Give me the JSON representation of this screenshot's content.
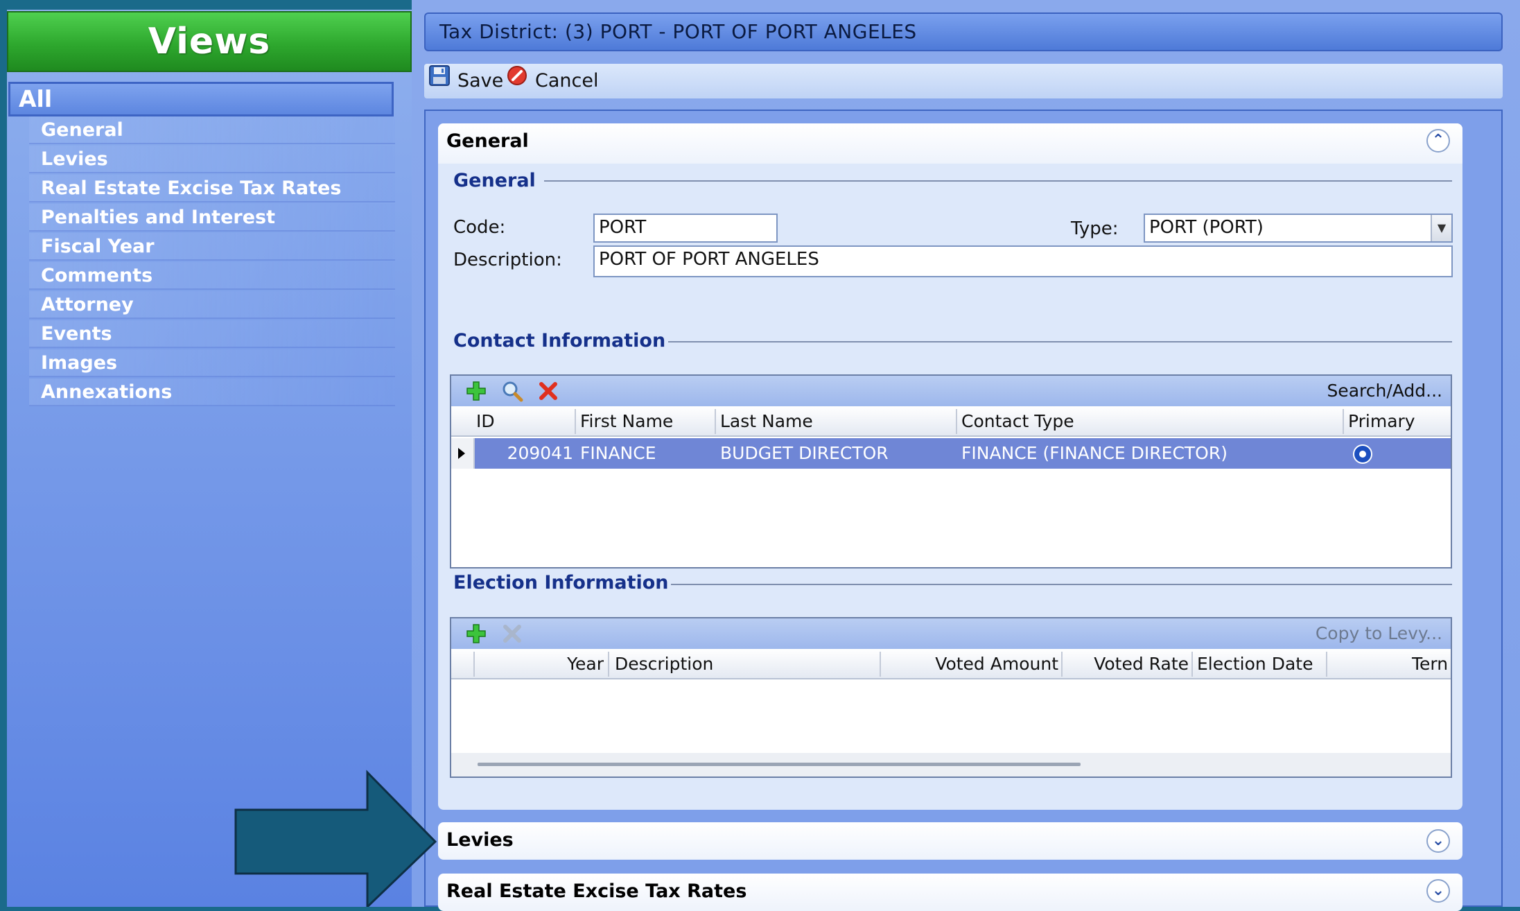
{
  "views": {
    "title": "Views",
    "all_label": "All",
    "items": [
      {
        "label": "General"
      },
      {
        "label": "Levies"
      },
      {
        "label": "Real Estate Excise Tax Rates"
      },
      {
        "label": "Penalties and Interest"
      },
      {
        "label": "Fiscal Year"
      },
      {
        "label": "Comments"
      },
      {
        "label": "Attorney"
      },
      {
        "label": "Events"
      },
      {
        "label": "Images"
      },
      {
        "label": "Annexations"
      }
    ]
  },
  "header": {
    "title": "Tax District: (3) PORT - PORT OF PORT ANGELES"
  },
  "toolbar": {
    "save_label": "Save",
    "cancel_label": "Cancel"
  },
  "general_section": {
    "title": "General",
    "group_title": "General",
    "code_label": "Code:",
    "code_value": "PORT",
    "type_label": "Type:",
    "type_value": "PORT (PORT)",
    "description_label": "Description:",
    "description_value": "PORT OF PORT ANGELES"
  },
  "contact": {
    "title": "Contact Information",
    "search_add": "Search/Add...",
    "columns": [
      "ID",
      "First Name",
      "Last Name",
      "Contact Type",
      "Primary"
    ],
    "rows": [
      {
        "id": "209041",
        "first_name": "FINANCE",
        "last_name": "BUDGET DIRECTOR",
        "contact_type": "FINANCE (FINANCE DIRECTOR)"
      }
    ]
  },
  "election": {
    "title": "Election Information",
    "copy_to_levy": "Copy to Levy...",
    "columns": [
      "Year",
      "Description",
      "Voted Amount",
      "Voted Rate",
      "Election Date",
      "Tern"
    ]
  },
  "sections": {
    "levies": "Levies",
    "reet": "Real Estate Excise Tax Rates"
  },
  "colors": {
    "views_header": "#2ea82e",
    "selected_row": "#6f86d6",
    "arrow": "#155a7a"
  }
}
